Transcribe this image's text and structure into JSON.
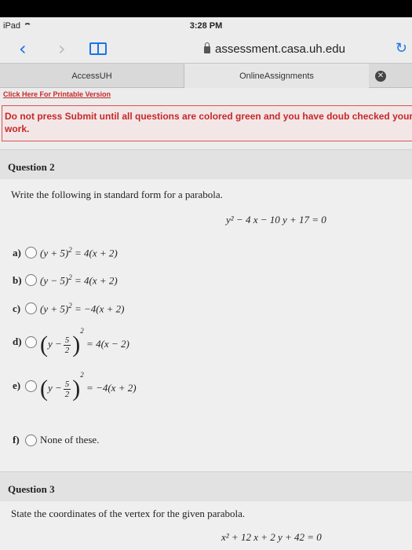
{
  "status": {
    "device": "iPad",
    "time": "3:28 PM"
  },
  "browser": {
    "url": "assessment.casa.uh.edu",
    "tabs": [
      {
        "label": "AccessUH"
      },
      {
        "label": "OnlineAssignments"
      }
    ]
  },
  "page": {
    "printable_link": "Click Here For Printable Version",
    "warning": "Do not press Submit until all questions are colored green and you have doub checked your work."
  },
  "question2": {
    "title": "Question 2",
    "prompt": "Write the following in standard form for a parabola.",
    "equation": "y² − 4 x − 10 y + 17 = 0",
    "options": [
      {
        "letter": "a)",
        "lhs": "(y + 5)",
        "exp": "2",
        "rhs": " = 4(x + 2)"
      },
      {
        "letter": "b)",
        "lhs": "(y − 5)",
        "exp": "2",
        "rhs": " = 4(x + 2)"
      },
      {
        "letter": "c)",
        "lhs": "(y + 5)",
        "exp": "2",
        "rhs": " = −4(x + 2)"
      },
      {
        "letter": "d)",
        "var": "y −",
        "num": "5",
        "den": "2",
        "exp": "2",
        "rhs": "= 4(x − 2)"
      },
      {
        "letter": "e)",
        "var": "y −",
        "num": "5",
        "den": "2",
        "exp": "2",
        "rhs": "= −4(x + 2)"
      },
      {
        "letter": "f)",
        "text": "None of these."
      }
    ]
  },
  "question3": {
    "title": "Question 3",
    "prompt": "State the coordinates of the vertex for the given parabola.",
    "equation": "x² + 12 x + 2 y + 42 = 0"
  }
}
